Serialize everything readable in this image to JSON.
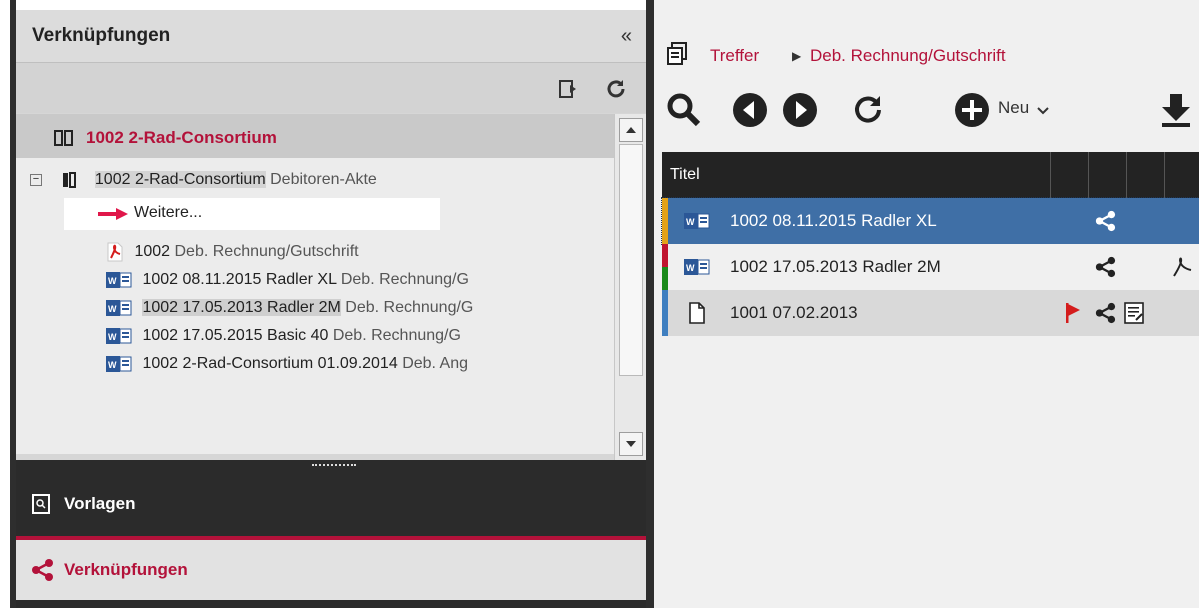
{
  "left_panel": {
    "title": "Verknüpfungen",
    "collapse_glyph": "«",
    "root": {
      "label": "1002  2-Rad-Consortium"
    },
    "tree": {
      "parent": {
        "label": "1002  2-Rad-Consortium",
        "type": "Debitoren-Akte"
      },
      "weitere": "Weitere...",
      "items": [
        {
          "label": "1002",
          "type": "Deb. Rechnung/Gutschrift",
          "icon": "pdf-icon"
        },
        {
          "label": "1002    08.11.2015  Radler XL",
          "type": "Deb. Rechnung/G",
          "icon": "word-icon"
        },
        {
          "label": "1002    17.05.2013  Radler 2M",
          "type": "Deb. Rechnung/G",
          "icon": "word-icon"
        },
        {
          "label": "1002    17.05.2015  Basic 40",
          "type": "Deb. Rechnung/G",
          "icon": "word-icon"
        },
        {
          "label": "1002  2-Rad-Consortium  01.09.2014",
          "type": "Deb. Ang",
          "icon": "word-icon"
        }
      ]
    },
    "accordion": {
      "vorlagen": "Vorlagen",
      "verknuepfungen": "Verknüpfungen"
    }
  },
  "right_panel": {
    "breadcrumb": {
      "root": "Treffer",
      "current": "Deb. Rechnung/Gutschrift"
    },
    "toolbar": {
      "neu": "Neu"
    },
    "grid": {
      "header": "Titel",
      "rows": [
        {
          "text": "1002    08.11.2015  Radler XL",
          "icon": "word-icon",
          "color": "#e3a21a"
        },
        {
          "text": "1002    17.05.2013  Radler 2M",
          "icon": "word-icon",
          "color": "#c0152f"
        },
        {
          "text": "1001    07.02.2013",
          "icon": "document-icon",
          "color": "#3f7fc0"
        }
      ]
    }
  },
  "colors": {
    "accent": "#b3123a",
    "selected": "#3f6fa6",
    "dark": "#2b2b2b"
  }
}
